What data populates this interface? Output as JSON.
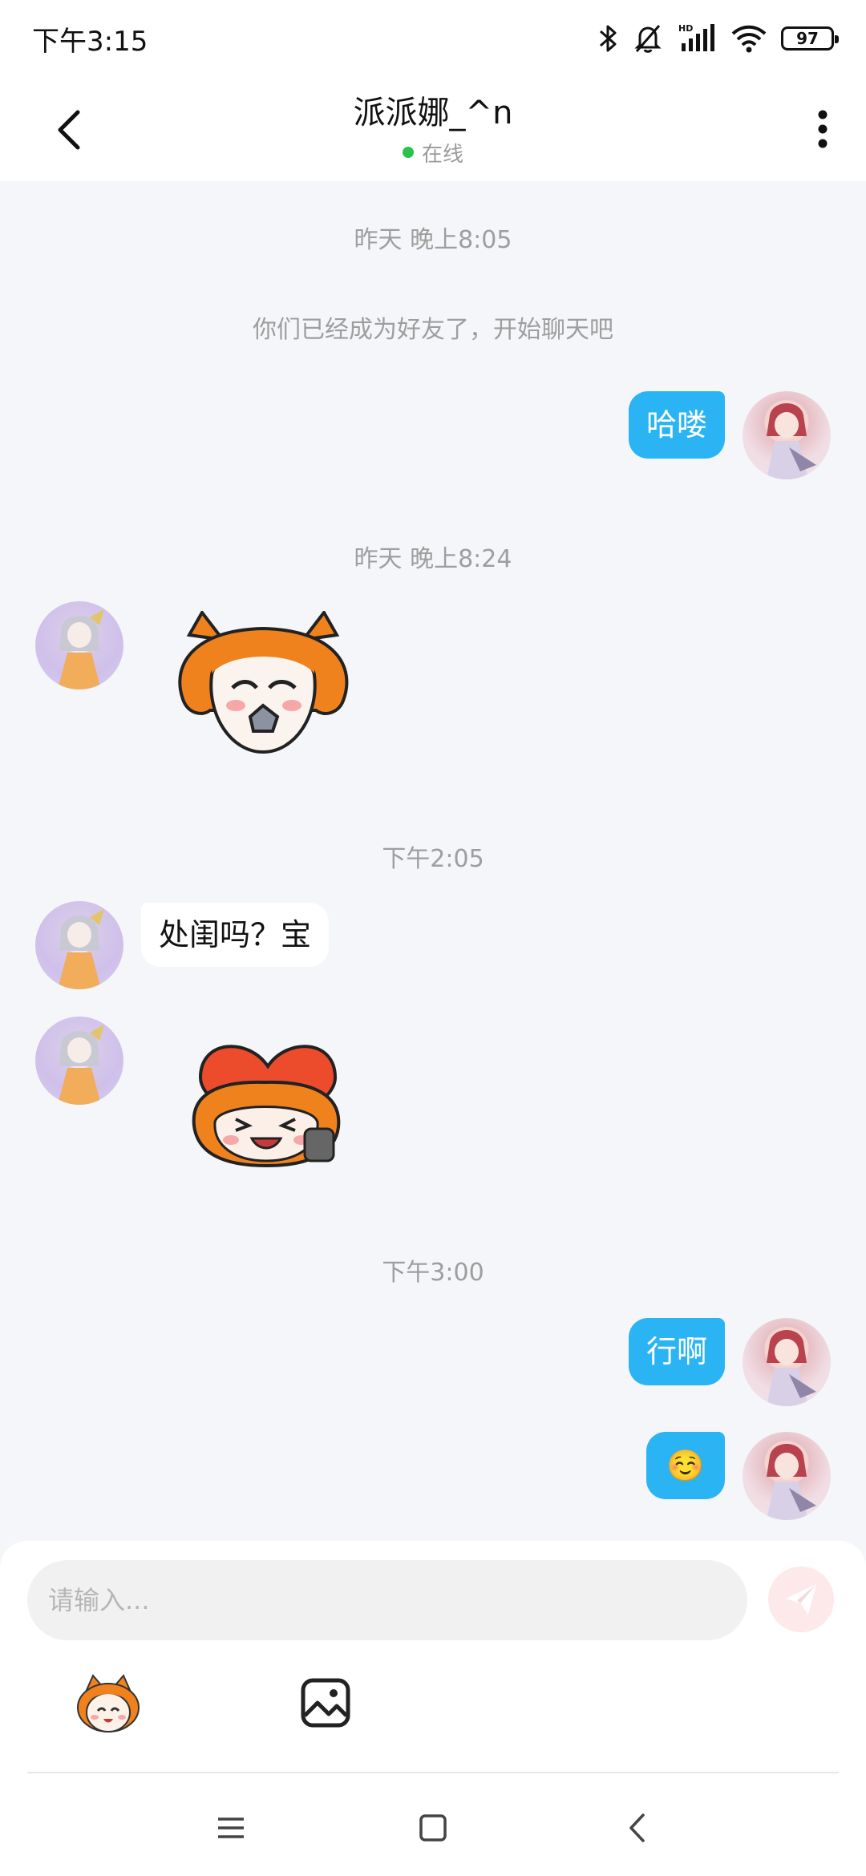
{
  "status_bar": {
    "time": "下午3:15",
    "battery": "97",
    "icons": [
      "bluetooth-icon",
      "bell-muted-icon",
      "hd-signal-icon",
      "wifi-icon",
      "battery-icon"
    ]
  },
  "header": {
    "title": "派派娜_^n",
    "status": "在线",
    "status_color": "#29c24a"
  },
  "chat": {
    "messages": [
      {
        "type": "timestamp",
        "text": "昨天 晚上8:05"
      },
      {
        "type": "system",
        "text": "你们已经成为好友了，开始聊天吧"
      },
      {
        "type": "text",
        "sender": "me",
        "text": "哈喽"
      },
      {
        "type": "timestamp",
        "text": "昨天 晚上8:24"
      },
      {
        "type": "sticker",
        "sender": "other",
        "sticker": "fox-girl-biting-sticker"
      },
      {
        "type": "timestamp",
        "text": "下午2:05"
      },
      {
        "type": "text",
        "sender": "other",
        "text": "处闺吗？宝"
      },
      {
        "type": "sticker",
        "sender": "other",
        "sticker": "girl-hugging-heart-sticker"
      },
      {
        "type": "timestamp",
        "text": "下午3:00"
      },
      {
        "type": "text",
        "sender": "me",
        "text": "行啊"
      },
      {
        "type": "text",
        "sender": "me",
        "text": "☺️"
      }
    ]
  },
  "composer": {
    "placeholder": "请输入...",
    "value": "",
    "send_icon": "send-paper-plane-icon",
    "tools": [
      "sticker-emoji-icon",
      "image-icon"
    ]
  },
  "colors": {
    "accent": "#2bb4f4",
    "background": "#f4f6f9",
    "send_disabled": "#fde8ea"
  },
  "nav_bar": {
    "buttons": [
      "menu-icon",
      "home-icon",
      "back-icon"
    ]
  }
}
